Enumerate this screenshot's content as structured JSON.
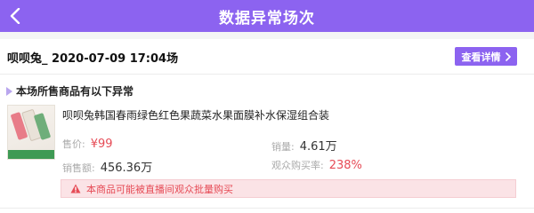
{
  "header": {
    "title": "数据异常场次"
  },
  "session": {
    "title": "呗呗兔_ 2020-07-09 17:04场",
    "detail_button": "查看详情"
  },
  "section_label": "本场所售商品有以下异常",
  "product": {
    "name": "呗呗兔韩国春雨绿色红色果蔬菜水果面膜补水保湿组合装",
    "stats": [
      {
        "key": "售价:",
        "value": "¥99"
      },
      {
        "key": "销量:",
        "value": "4.61万"
      },
      {
        "key": "销售额:",
        "value": "456.36万"
      },
      {
        "key": "观众购买率:",
        "value": "238%"
      }
    ]
  },
  "warning": "本商品可能被直播间观众批量购买",
  "colors": {
    "accent": "#8c63f0",
    "alert": "#e64b56",
    "alert_bg": "#fbe3e6"
  },
  "icons": {
    "back": "chevron-left-icon",
    "detail": "chevron-right-icon",
    "warning": "warning-triangle-icon"
  }
}
